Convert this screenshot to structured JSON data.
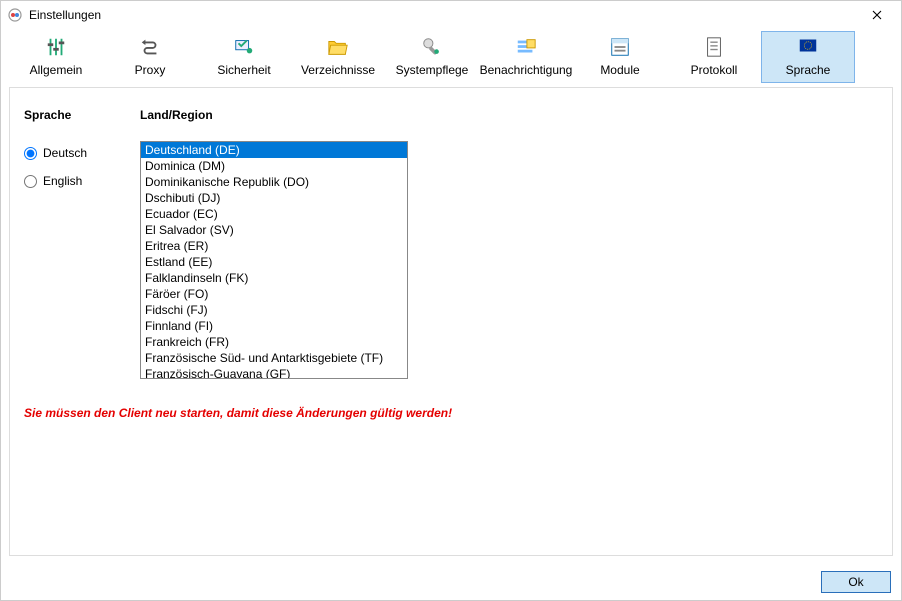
{
  "window": {
    "title": "Einstellungen"
  },
  "toolbar": {
    "items": [
      {
        "id": "allgemein",
        "label": "Allgemein"
      },
      {
        "id": "proxy",
        "label": "Proxy"
      },
      {
        "id": "sicherheit",
        "label": "Sicherheit"
      },
      {
        "id": "verzeichnisse",
        "label": "Verzeichnisse"
      },
      {
        "id": "systempflege",
        "label": "Systempflege"
      },
      {
        "id": "benachrichtigung",
        "label": "Benachrichtigung"
      },
      {
        "id": "module",
        "label": "Module"
      },
      {
        "id": "protokoll",
        "label": "Protokoll"
      },
      {
        "id": "sprache",
        "label": "Sprache"
      }
    ],
    "active": "sprache"
  },
  "main": {
    "language_label": "Sprache",
    "region_label": "Land/Region",
    "languages": [
      {
        "value": "de",
        "label": "Deutsch",
        "selected": true
      },
      {
        "value": "en",
        "label": "English",
        "selected": false
      }
    ],
    "regions": [
      {
        "label": "Deutschland (DE)",
        "selected": true
      },
      {
        "label": "Dominica (DM)"
      },
      {
        "label": "Dominikanische Republik (DO)"
      },
      {
        "label": "Dschibuti (DJ)"
      },
      {
        "label": "Ecuador (EC)"
      },
      {
        "label": "El Salvador (SV)"
      },
      {
        "label": "Eritrea (ER)"
      },
      {
        "label": "Estland (EE)"
      },
      {
        "label": "Falklandinseln (FK)"
      },
      {
        "label": "Färöer (FO)"
      },
      {
        "label": "Fidschi (FJ)"
      },
      {
        "label": "Finnland (FI)"
      },
      {
        "label": "Frankreich (FR)"
      },
      {
        "label": "Französische Süd- und Antarktisgebiete (TF)"
      },
      {
        "label": "Französisch-Guayana (GF)"
      }
    ],
    "warning": "Sie müssen den Client neu starten, damit diese Änderungen gültig werden!"
  },
  "footer": {
    "ok_label": "Ok"
  }
}
